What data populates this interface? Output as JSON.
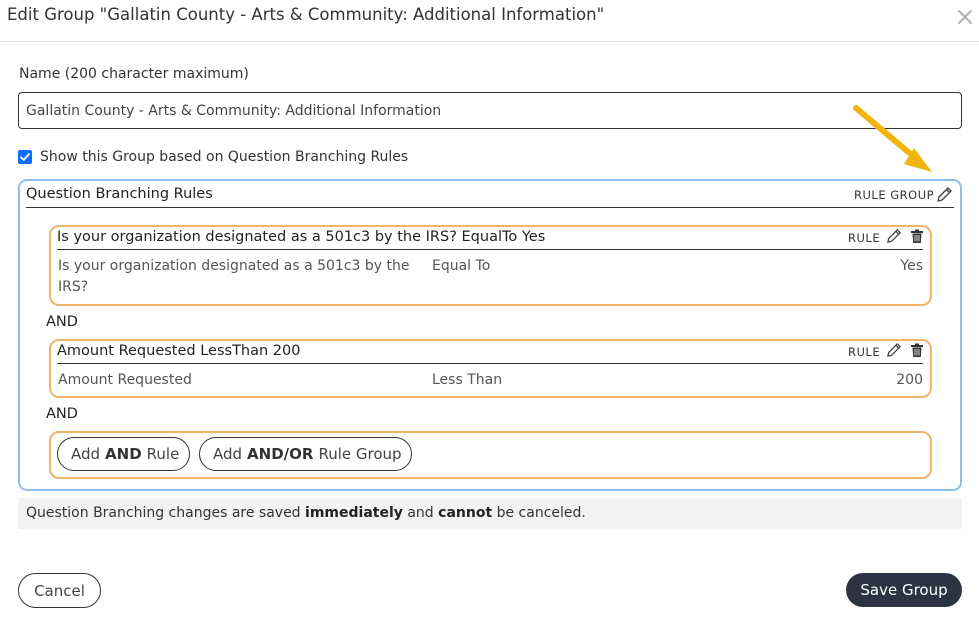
{
  "modal": {
    "title": "Edit Group \"Gallatin County - Arts & Community: Additional Information\"",
    "close_icon": "close-icon"
  },
  "name_field": {
    "label": "Name (200 character maximum)",
    "value": "Gallatin County - Arts & Community: Additional Information"
  },
  "show_group": {
    "checked": true,
    "label": "Show this Group based on Question Branching Rules"
  },
  "branching": {
    "title": "Question Branching Rules",
    "group_tag": "RULE GROUP",
    "edit_icon": "pencil-icon",
    "rules": [
      {
        "title": "Is your organization designated as a 501c3 by the IRS? EqualTo Yes",
        "tag": "RULE",
        "question_line1": "Is your organization designated as a 501c3 by the",
        "question_line2": "IRS?",
        "operator": "Equal To",
        "value": "Yes"
      },
      {
        "title": "Amount Requested LessThan 200",
        "tag": "RULE",
        "question_line1": "Amount Requested",
        "question_line2": "",
        "operator": "Less Than",
        "value": "200"
      }
    ],
    "connector_1": "AND",
    "connector_2": "AND",
    "add_rule": {
      "pre": "Add",
      "bold": "AND",
      "post": "Rule"
    },
    "add_group": {
      "pre": "Add",
      "bold": "AND/OR",
      "post": "Rule Group"
    }
  },
  "note": {
    "part1": "Question Branching changes are saved",
    "bold1": "immediately",
    "part2": "and",
    "bold2": "cannot",
    "part3": "be canceled."
  },
  "footer": {
    "cancel_label": "Cancel",
    "save_label": "Save Group"
  },
  "colors": {
    "checkbox": "#0d6efd",
    "group_border": "#8cc0ec",
    "rule_border": "#f0b56b",
    "save_button": "#2c3444",
    "arrow": "#f3b40e"
  }
}
